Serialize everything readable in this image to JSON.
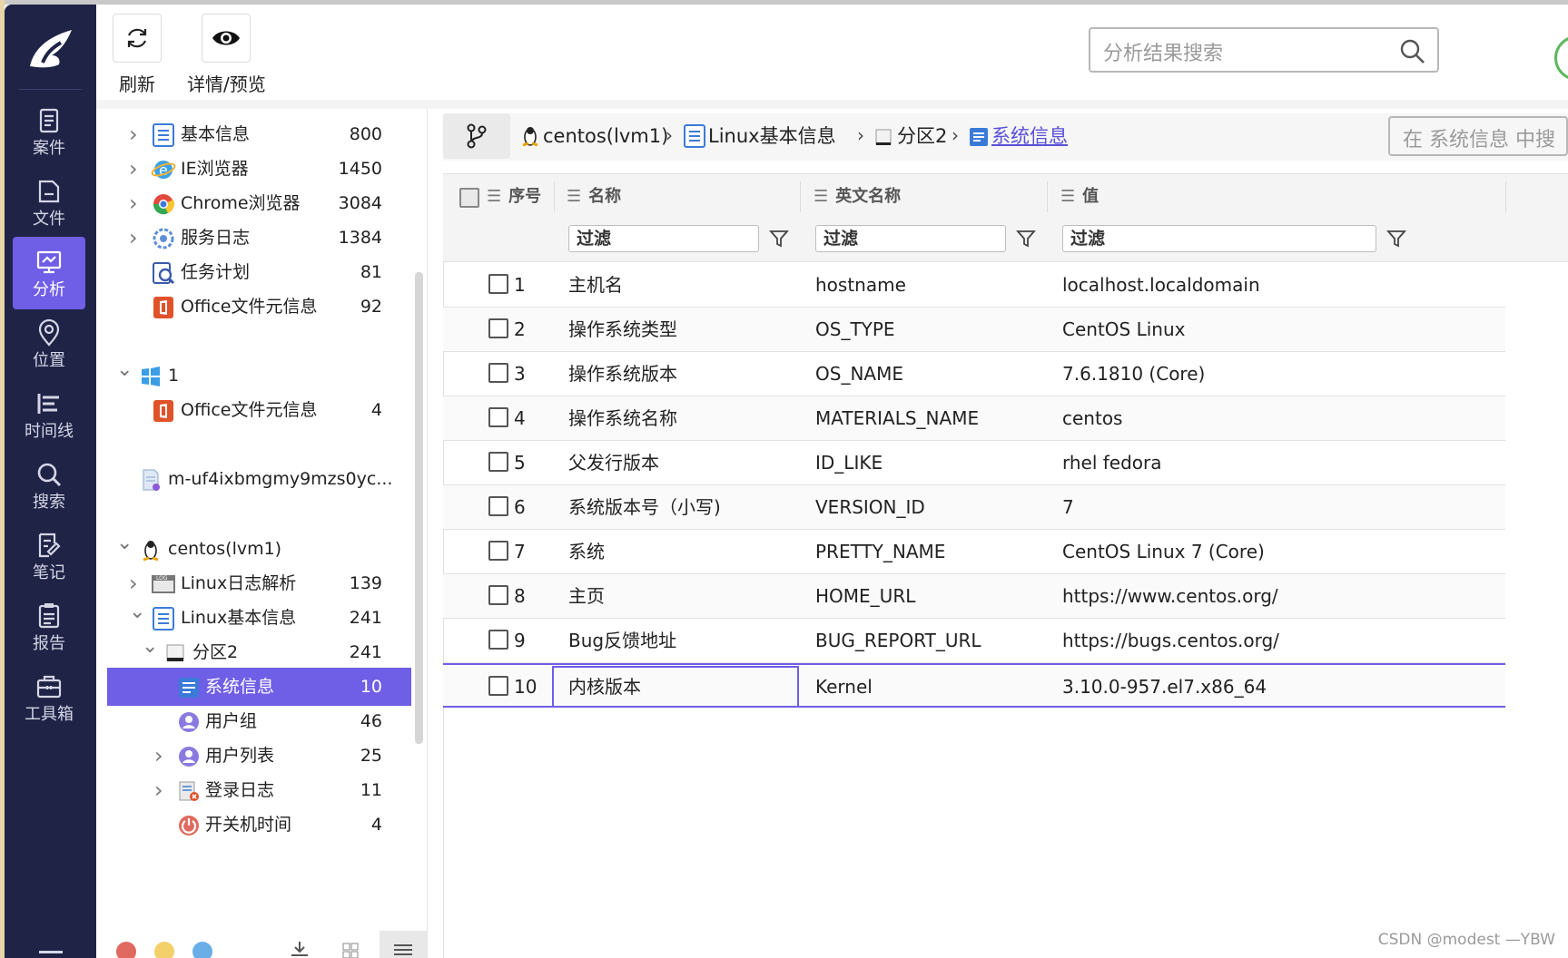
{
  "sidebar": {
    "items": [
      {
        "label": "案件",
        "icon": "case-icon"
      },
      {
        "label": "文件",
        "icon": "file-icon"
      },
      {
        "label": "分析",
        "icon": "analysis-icon",
        "active": true
      },
      {
        "label": "位置",
        "icon": "location-icon"
      },
      {
        "label": "时间线",
        "icon": "timeline-icon"
      },
      {
        "label": "搜索",
        "icon": "search-icon"
      },
      {
        "label": "笔记",
        "icon": "notes-icon"
      },
      {
        "label": "报告",
        "icon": "report-icon"
      },
      {
        "label": "工具箱",
        "icon": "toolbox-icon"
      }
    ]
  },
  "toolbar": {
    "refresh_label": "刷新",
    "preview_label": "详情/预览",
    "search_placeholder": "分析结果搜索"
  },
  "tree": {
    "items": [
      {
        "label": "基本信息",
        "count": "800",
        "icon": "list-icon",
        "chevron": "right"
      },
      {
        "label": "IE浏览器",
        "count": "1450",
        "icon": "ie-icon",
        "chevron": "right"
      },
      {
        "label": "Chrome浏览器",
        "count": "3084",
        "icon": "chrome-icon",
        "chevron": "right"
      },
      {
        "label": "服务日志",
        "count": "1384",
        "icon": "service-icon",
        "chevron": "right"
      },
      {
        "label": "任务计划",
        "count": "81",
        "icon": "task-icon",
        "chevron": ""
      },
      {
        "label": "Office文件元信息",
        "count": "92",
        "icon": "office-icon",
        "chevron": ""
      },
      {
        "label": "1",
        "count": "",
        "icon": "windows-icon",
        "chevron": "down"
      },
      {
        "label": "Office文件元信息",
        "count": "4",
        "icon": "office-icon",
        "chevron": ""
      },
      {
        "label": "m-uf4ixbmgmy9mzs0yc...",
        "count": "",
        "icon": "disk-image-icon",
        "chevron": ""
      },
      {
        "label": "centos(lvm1)",
        "count": "",
        "icon": "linux-icon",
        "chevron": "down"
      },
      {
        "label": "Linux日志解析",
        "count": "139",
        "icon": "log-icon",
        "chevron": "right"
      },
      {
        "label": "Linux基本信息",
        "count": "241",
        "icon": "list-icon",
        "chevron": "down"
      },
      {
        "label": "分区2",
        "count": "241",
        "icon": "partition-icon",
        "chevron": "down"
      },
      {
        "label": "系统信息",
        "count": "10",
        "icon": "sysinfo-icon",
        "chevron": "",
        "selected": true
      },
      {
        "label": "用户组",
        "count": "46",
        "icon": "user-icon",
        "chevron": ""
      },
      {
        "label": "用户列表",
        "count": "25",
        "icon": "user-icon",
        "chevron": "right"
      },
      {
        "label": "登录日志",
        "count": "11",
        "icon": "login-log-icon",
        "chevron": "right"
      },
      {
        "label": "开关机时间",
        "count": "4",
        "icon": "power-icon",
        "chevron": ""
      }
    ]
  },
  "breadcrumb": {
    "items": [
      "centos(lvm1)",
      "Linux基本信息",
      "分区2",
      "系统信息"
    ],
    "search_placeholder": "在 系统信息 中搜"
  },
  "table": {
    "headers": [
      "序号",
      "名称",
      "英文名称",
      "值"
    ],
    "filter_placeholder": "过滤",
    "rows": [
      {
        "no": "1",
        "name": "主机名",
        "en": "hostname",
        "value": "localhost.localdomain"
      },
      {
        "no": "2",
        "name": "操作系统类型",
        "en": "OS_TYPE",
        "value": "CentOS Linux"
      },
      {
        "no": "3",
        "name": "操作系统版本",
        "en": "OS_NAME",
        "value": "7.6.1810 (Core)"
      },
      {
        "no": "4",
        "name": "操作系统名称",
        "en": "MATERIALS_NAME",
        "value": "centos"
      },
      {
        "no": "5",
        "name": "父发行版本",
        "en": "ID_LIKE",
        "value": "rhel fedora"
      },
      {
        "no": "6",
        "name": "系统版本号（小写)",
        "en": "VERSION_ID",
        "value": "7"
      },
      {
        "no": "7",
        "name": "系统",
        "en": "PRETTY_NAME",
        "value": "CentOS Linux 7 (Core)"
      },
      {
        "no": "8",
        "name": "主页",
        "en": "HOME_URL",
        "value": "https://www.centos.org/"
      },
      {
        "no": "9",
        "name": "Bug反馈地址",
        "en": "BUG_REPORT_URL",
        "value": "https://bugs.centos.org/"
      },
      {
        "no": "10",
        "name": "内核版本",
        "en": "Kernel",
        "value": "3.10.0-957.el7.x86_64"
      }
    ]
  },
  "watermark": "CSDN @modest —YBW",
  "colors": {
    "sidebar_bg": "#1f2346",
    "accent": "#6f5ee6"
  }
}
